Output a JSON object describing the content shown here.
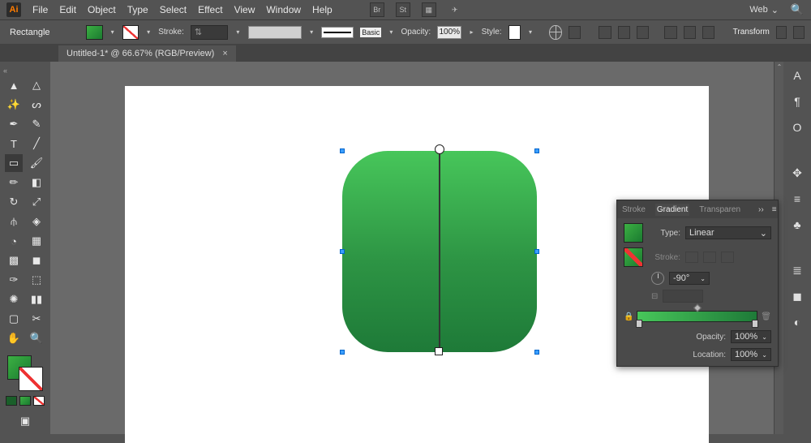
{
  "app_logo": "Ai",
  "menu": [
    "File",
    "Edit",
    "Object",
    "Type",
    "Select",
    "Effect",
    "View",
    "Window",
    "Help"
  ],
  "top_icons": [
    "Br",
    "St"
  ],
  "workspace_label": "Web",
  "control": {
    "shape": "Rectangle",
    "stroke_label": "Stroke:",
    "brush_basic": "Basic",
    "opacity_label": "Opacity:",
    "opacity_value": "100%",
    "style_label": "Style:",
    "transform_label": "Transform"
  },
  "doc_tab": "Untitled-1* @ 66.67% (RGB/Preview)",
  "gradient_panel": {
    "tabs": [
      "Stroke",
      "Gradient",
      "Transparen"
    ],
    "type_label": "Type:",
    "type_value": "Linear",
    "stroke_lbl": "Stroke:",
    "angle_value": "-90°",
    "opacity_label": "Opacity:",
    "opacity_value": "100%",
    "location_label": "Location:",
    "location_value": "100%"
  }
}
